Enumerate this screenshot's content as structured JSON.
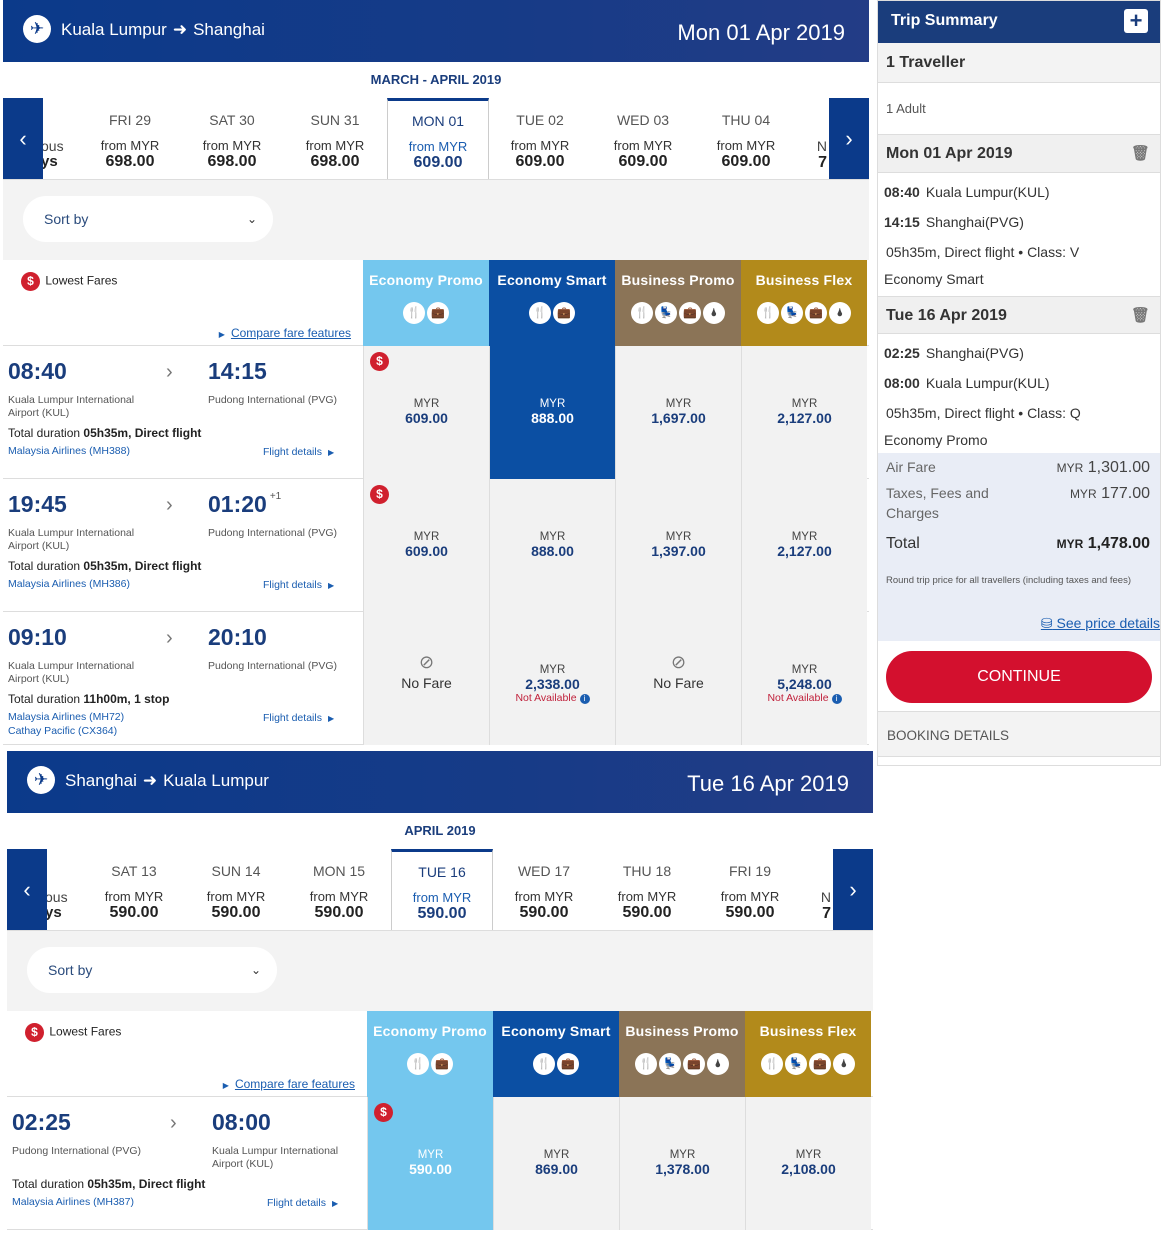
{
  "outbound": {
    "route_from": "Kuala Lumpur",
    "route_to": "Shanghai",
    "date": "Mon 01 Apr 2019",
    "month_label": "MARCH - APRIL 2019",
    "prev_fragment": [
      "ous",
      "ys"
    ],
    "next_fragment": [
      "N",
      "7"
    ],
    "dates": [
      {
        "day": "FRI 29",
        "from": "from MYR",
        "price": "698.00"
      },
      {
        "day": "SAT 30",
        "from": "from MYR",
        "price": "698.00"
      },
      {
        "day": "SUN 31",
        "from": "from MYR",
        "price": "698.00"
      },
      {
        "day": "MON 01",
        "from": "from MYR",
        "price": "609.00",
        "selected": true
      },
      {
        "day": "TUE 02",
        "from": "from MYR",
        "price": "609.00"
      },
      {
        "day": "WED 03",
        "from": "from MYR",
        "price": "609.00"
      },
      {
        "day": "THU 04",
        "from": "from MYR",
        "price": "609.00"
      }
    ],
    "sort_label": "Sort by",
    "lowest_label": "Lowest Fares",
    "compare_label": "Compare fare features",
    "fare_headers": [
      "Economy Promo",
      "Economy Smart",
      "Business Promo",
      "Business Flex"
    ],
    "flights": [
      {
        "dep": "08:40",
        "arr": "14:15",
        "arr_plus": "",
        "dep_airport": "Kuala Lumpur International Airport (KUL)",
        "arr_airport": "Pudong International (PVG)",
        "duration_prefix": "Total duration ",
        "duration": "05h35m, Direct flight",
        "airlines": [
          "Malaysia Airlines (MH388)"
        ],
        "details": "Flight details",
        "fares": [
          {
            "cur": "MYR",
            "amt": "609.00"
          },
          {
            "cur": "MYR",
            "amt": "888.00"
          },
          {
            "cur": "MYR",
            "amt": "1,697.00"
          },
          {
            "cur": "MYR",
            "amt": "2,127.00"
          }
        ]
      },
      {
        "dep": "19:45",
        "arr": "01:20",
        "arr_plus": "+1",
        "dep_airport": "Kuala Lumpur International Airport (KUL)",
        "arr_airport": "Pudong International (PVG)",
        "duration_prefix": "Total duration ",
        "duration": "05h35m, Direct flight",
        "airlines": [
          "Malaysia Airlines (MH386)"
        ],
        "details": "Flight details",
        "fares": [
          {
            "cur": "MYR",
            "amt": "609.00"
          },
          {
            "cur": "MYR",
            "amt": "888.00"
          },
          {
            "cur": "MYR",
            "amt": "1,397.00"
          },
          {
            "cur": "MYR",
            "amt": "2,127.00"
          }
        ]
      },
      {
        "dep": "09:10",
        "arr": "20:10",
        "arr_plus": "",
        "dep_airport": "Kuala Lumpur International Airport (KUL)",
        "arr_airport": "Pudong International (PVG)",
        "duration_prefix": "Total duration ",
        "duration": "11h00m, 1 stop",
        "airlines": [
          "Malaysia Airlines (MH72)",
          "Cathay Pacific (CX364)"
        ],
        "details": "Flight details",
        "fares": [
          {
            "nofare": "No Fare"
          },
          {
            "cur": "MYR",
            "amt": "2,338.00",
            "na": "Not Available"
          },
          {
            "nofare": "No Fare"
          },
          {
            "cur": "MYR",
            "amt": "5,248.00",
            "na": "Not Available"
          }
        ]
      }
    ]
  },
  "inbound": {
    "route_from": "Shanghai",
    "route_to": "Kuala Lumpur",
    "date": "Tue 16 Apr 2019",
    "month_label": "APRIL 2019",
    "prev_fragment": [
      "ous",
      "ys"
    ],
    "next_fragment": [
      "N",
      "7"
    ],
    "dates": [
      {
        "day": "SAT 13",
        "from": "from MYR",
        "price": "590.00"
      },
      {
        "day": "SUN 14",
        "from": "from MYR",
        "price": "590.00"
      },
      {
        "day": "MON 15",
        "from": "from MYR",
        "price": "590.00"
      },
      {
        "day": "TUE 16",
        "from": "from MYR",
        "price": "590.00",
        "selected": true
      },
      {
        "day": "WED 17",
        "from": "from MYR",
        "price": "590.00"
      },
      {
        "day": "THU 18",
        "from": "from MYR",
        "price": "590.00"
      },
      {
        "day": "FRI 19",
        "from": "from MYR",
        "price": "590.00"
      }
    ],
    "sort_label": "Sort by",
    "lowest_label": "Lowest Fares",
    "compare_label": "Compare fare features",
    "fare_headers": [
      "Economy Promo",
      "Economy Smart",
      "Business Promo",
      "Business Flex"
    ],
    "flights": [
      {
        "dep": "02:25",
        "arr": "08:00",
        "arr_plus": "",
        "dep_airport": "Pudong International (PVG)",
        "arr_airport": "Kuala Lumpur International Airport (KUL)",
        "duration_prefix": "Total duration ",
        "duration": "05h35m, Direct flight",
        "airlines": [
          "Malaysia Airlines (MH387)"
        ],
        "details": "Flight details",
        "fares": [
          {
            "cur": "MYR",
            "amt": "590.00"
          },
          {
            "cur": "MYR",
            "amt": "869.00"
          },
          {
            "cur": "MYR",
            "amt": "1,378.00"
          },
          {
            "cur": "MYR",
            "amt": "2,108.00"
          }
        ]
      }
    ]
  },
  "summary": {
    "title": "Trip Summary",
    "travellers": "1 Traveller",
    "adult": "1 Adult",
    "out_date": "Mon 01 Apr 2019",
    "out_dep_time": "08:40",
    "out_dep_place": "Kuala Lumpur(KUL)",
    "out_arr_time": "14:15",
    "out_arr_place": "Shanghai(PVG)",
    "out_info": "05h35m, Direct flight  • Class: V",
    "out_class": "Economy Smart",
    "in_date": "Tue 16 Apr 2019",
    "in_dep_time": "02:25",
    "in_dep_place": "Shanghai(PVG)",
    "in_arr_time": "08:00",
    "in_arr_place": "Kuala Lumpur(KUL)",
    "in_info": "05h35m, Direct flight  • Class: Q",
    "in_class": "Economy Promo",
    "air_fare_label": "Air Fare",
    "air_fare_cur": "MYR",
    "air_fare": "1,301.00",
    "taxes_label": "Taxes, Fees and Charges",
    "taxes_cur": "MYR",
    "taxes": "177.00",
    "total_label": "Total",
    "total_cur": "MYR",
    "total": "1,478.00",
    "note": "Round trip price for all travellers (including taxes and fees)",
    "see_details": "See price details",
    "continue": "CONTINUE",
    "booking_details": "BOOKING DETAILS"
  },
  "colors": {
    "brand_blue": "#0b3a8a",
    "economy_promo": "#74c7ee",
    "economy_smart": "#0b4fa3",
    "business_promo": "#8b7457",
    "business_flex": "#b28a1b",
    "continue": "#d3102e",
    "lowest_badge": "#d0202e"
  }
}
